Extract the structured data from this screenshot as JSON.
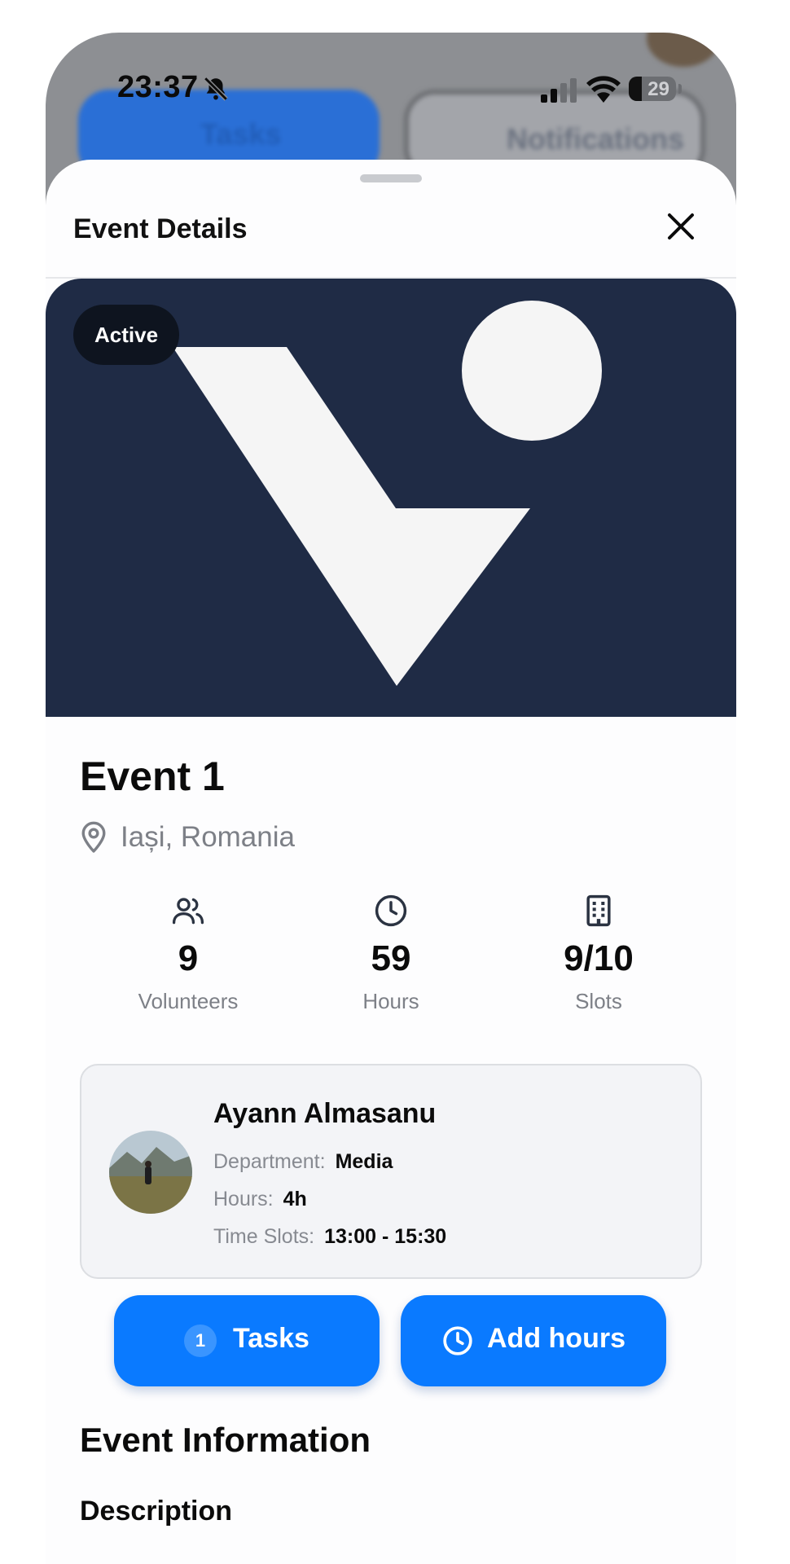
{
  "status_bar": {
    "time": "23:37",
    "battery": "29"
  },
  "background_app": {
    "tasks_label": "Tasks",
    "notifications_label": "Notifications"
  },
  "sheet": {
    "title": "Event Details"
  },
  "event": {
    "status_badge": "Active",
    "title": "Event 1",
    "location": "Iași, Romania",
    "stats": [
      {
        "icon": "users-icon",
        "value": "9",
        "label": "Volunteers"
      },
      {
        "icon": "clock-icon",
        "value": "59",
        "label": "Hours"
      },
      {
        "icon": "building-icon",
        "value": "9/10",
        "label": "Slots"
      }
    ]
  },
  "volunteer": {
    "name": "Ayann Almasanu",
    "department_label": "Department:",
    "department": "Media",
    "hours_label": "Hours:",
    "hours": "4h",
    "time_slots_label": "Time Slots:",
    "time_slots": "13:00 - 15:30"
  },
  "actions": {
    "tasks_count": "1",
    "tasks_label": "Tasks",
    "add_hours_label": "Add hours"
  },
  "info": {
    "section_title": "Event Information",
    "description_title": "Description"
  },
  "colors": {
    "accent": "#0a7aff",
    "hero_bg": "#1f2b45",
    "badge_bg": "#0e141f",
    "muted_text": "#7d8087"
  }
}
